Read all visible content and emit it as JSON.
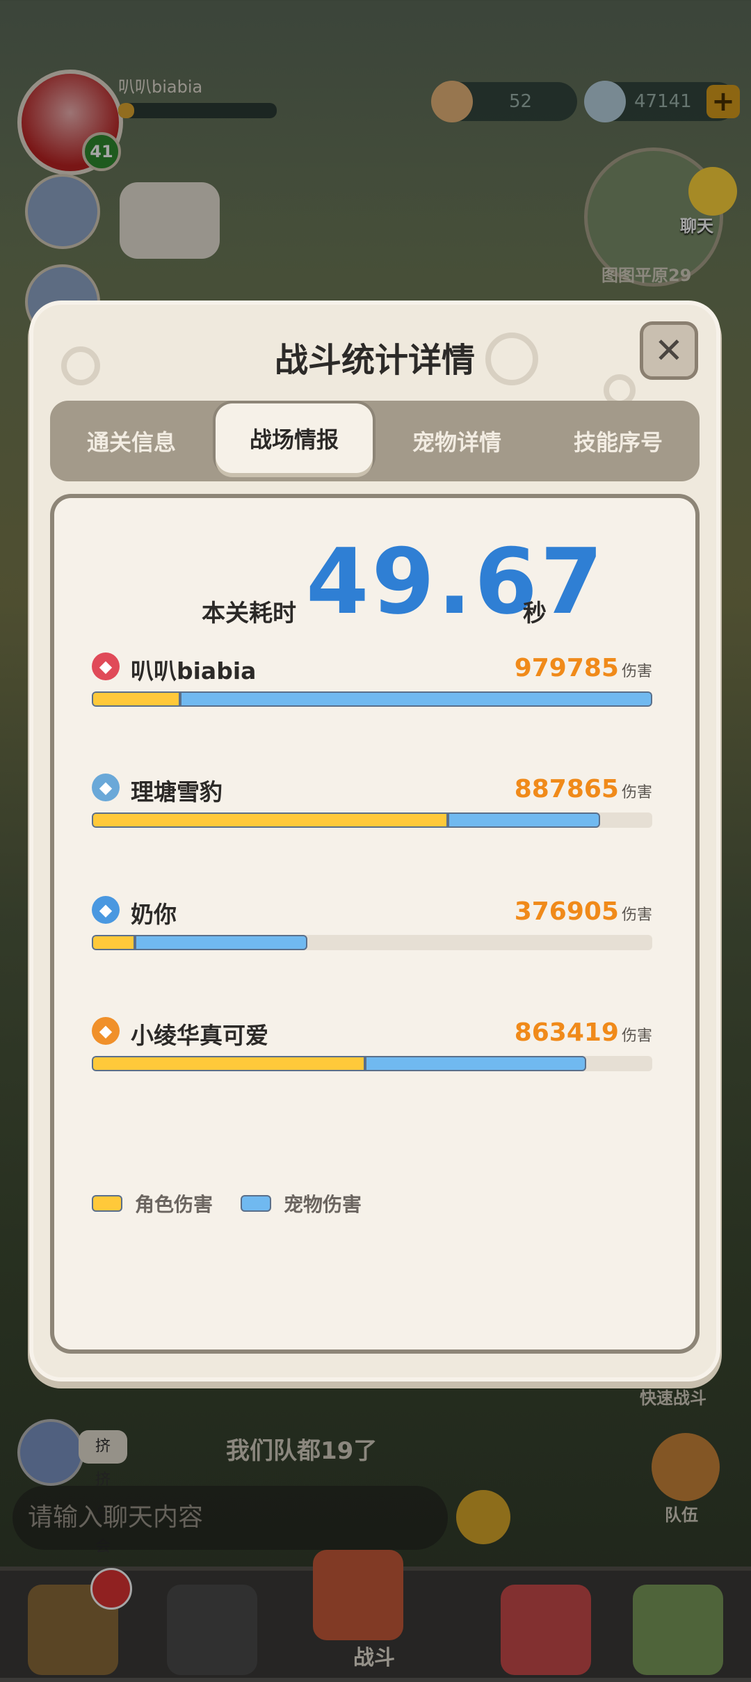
{
  "hud": {
    "player_name": "叭叭biabia",
    "level": "41",
    "food_count": "52",
    "gem_count": "47141",
    "plus_label": "+",
    "chat_label": "聊天",
    "map_name": "图图平原29"
  },
  "modal": {
    "title": "战斗统计详情",
    "close_label": "✕",
    "tabs": [
      {
        "label": "通关信息",
        "active": false
      },
      {
        "label": "战场情报",
        "active": true
      },
      {
        "label": "宠物详情",
        "active": false
      },
      {
        "label": "技能序号",
        "active": false
      }
    ],
    "time_label": "本关耗时",
    "time_value": "49.67",
    "time_unit": "秒",
    "damage_unit": "伤害",
    "players": [
      {
        "name": "叭叭biabia",
        "damage": "979785",
        "char_fraction": 0.157,
        "pet_fraction": 0.843,
        "icon": "red-sword-emblem-icon",
        "icon_color": "#e04a58"
      },
      {
        "name": "理塘雪豹",
        "damage": "887865",
        "char_fraction": 0.635,
        "pet_fraction": 0.272,
        "icon": "blue-crossed-swords-icon",
        "icon_color": "#6aa8d8"
      },
      {
        "name": "奶你",
        "damage": "376905",
        "char_fraction": 0.077,
        "pet_fraction": 0.308,
        "icon": "blue-swirl-icon",
        "icon_color": "#4a98e0"
      },
      {
        "name": "小绫华真可爱",
        "damage": "863419",
        "char_fraction": 0.487,
        "pet_fraction": 0.395,
        "icon": "orange-flame-icon",
        "icon_color": "#f0902a"
      }
    ],
    "legend": {
      "char_label": "角色伤害",
      "pet_label": "宠物伤害",
      "char_color": "#ffc93a",
      "pet_color": "#70b9f0"
    }
  },
  "bottom": {
    "quick_battle": "快速战斗",
    "team": "队伍",
    "chat_sender": "挤挤总会有的",
    "chat_message": "我们队都19了",
    "chat_placeholder": "请输入聊天内容",
    "battle_tab": "战斗"
  }
}
